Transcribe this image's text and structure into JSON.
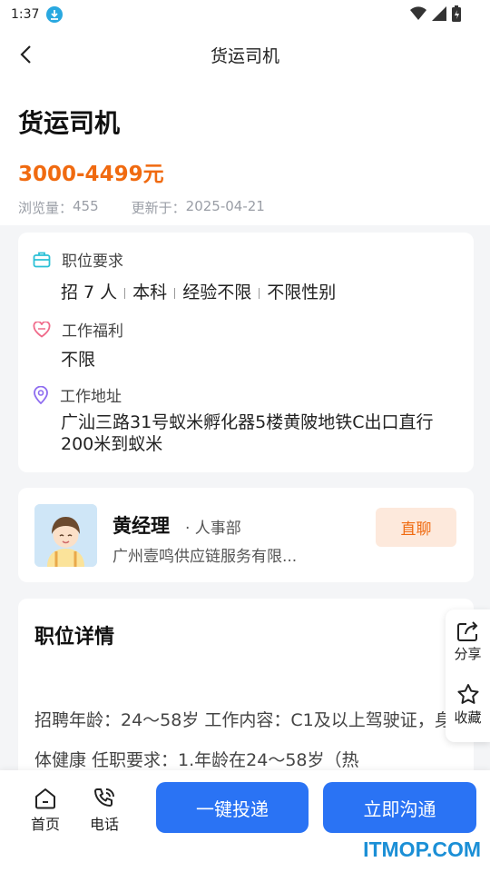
{
  "status": {
    "time": "1:37"
  },
  "nav": {
    "title": "货运司机"
  },
  "job": {
    "title": "货运司机",
    "salary": "3000-4499元",
    "views_label": "浏览量：",
    "views": "455",
    "updated_label": "更新于：",
    "updated": "2025-04-21"
  },
  "requirements": {
    "label": "职位要求",
    "items": [
      "招 7 人",
      "本科",
      "经验不限",
      "不限性别"
    ]
  },
  "benefits": {
    "label": "工作福利",
    "value": "不限"
  },
  "address": {
    "label": "工作地址",
    "value": "广汕三路31号蚁米孵化器5楼黄陂地铁C出口直行200米到蚁米"
  },
  "contact": {
    "name": "黄经理",
    "dept": "· 人事部",
    "company": "广州壹鸣供应链服务有限...",
    "chat_label": "直聊"
  },
  "detail": {
    "title": "职位详情",
    "text": "招聘年龄：24～58岁 工作内容：C1及以上驾驶证，身体健康 任职要求：1.年龄在24～58岁（热"
  },
  "float": {
    "share": "分享",
    "favorite": "收藏"
  },
  "bottom": {
    "home": "首页",
    "phone": "电话",
    "apply": "一键投递",
    "chat": "立即沟通"
  },
  "watermark": "ITMOP.COM",
  "colors": {
    "accent": "#2a73f4",
    "salary": "#f06a10",
    "watermark": "#1b8fd6"
  }
}
